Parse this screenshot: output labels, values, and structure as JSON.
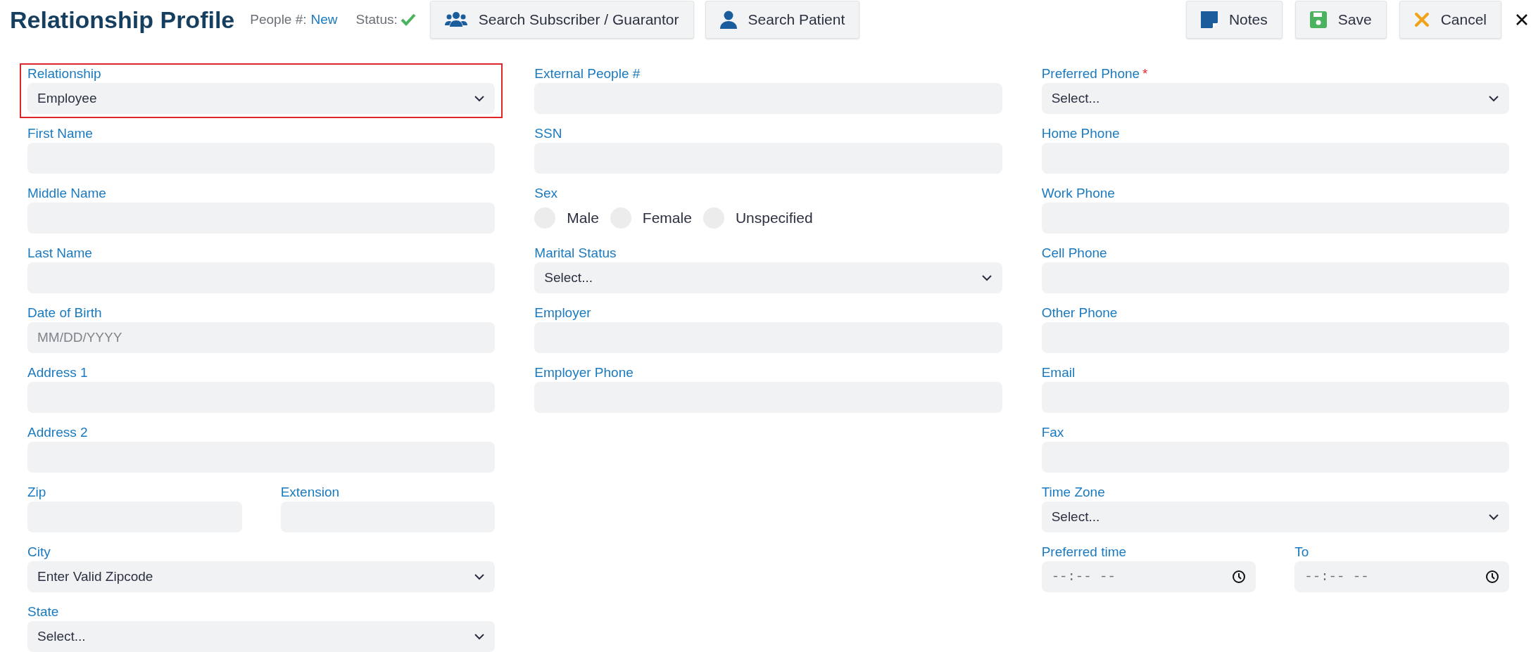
{
  "header": {
    "title": "Relationship Profile",
    "people_label": "People #:",
    "people_value": "New",
    "status_label": "Status:",
    "search_buttons": [
      {
        "label": "Search Subscriber / Guarantor",
        "kind": "group"
      },
      {
        "label": "Search Patient",
        "kind": "person"
      }
    ],
    "action_buttons": [
      {
        "label": "Notes",
        "kind": "notes"
      },
      {
        "label": "Save",
        "kind": "save"
      },
      {
        "label": "Cancel",
        "kind": "cancel"
      }
    ]
  },
  "columns": [
    [
      {
        "fields": [
          {
            "label": "Relationship",
            "kind": "select",
            "value": "Employee",
            "highlighted": true
          }
        ]
      },
      {
        "fields": [
          {
            "label": "First Name",
            "kind": "text",
            "highlighted": false
          }
        ]
      },
      {
        "fields": [
          {
            "label": "Middle Name",
            "kind": "text",
            "highlighted": false
          }
        ]
      },
      {
        "fields": [
          {
            "label": "Last Name",
            "kind": "text",
            "highlighted": false
          }
        ]
      },
      {
        "fields": [
          {
            "label": "Date of Birth",
            "kind": "text",
            "placeholder": "MM/DD/YYYY",
            "highlighted": false
          }
        ]
      },
      {
        "fields": [
          {
            "label": "Address 1",
            "kind": "text",
            "highlighted": false
          }
        ]
      },
      {
        "fields": [
          {
            "label": "Address 2",
            "kind": "text",
            "highlighted": false
          }
        ]
      },
      {
        "fields": [
          {
            "label": "Zip",
            "kind": "text",
            "highlighted": false
          },
          {
            "label": "Extension",
            "kind": "text",
            "highlighted": false
          }
        ]
      },
      {
        "fields": [
          {
            "label": "City",
            "kind": "select",
            "value": "Enter Valid Zipcode",
            "highlighted": false
          }
        ]
      },
      {
        "fields": [
          {
            "label": "State",
            "kind": "select",
            "value": "Select...",
            "highlighted": false
          }
        ]
      }
    ],
    [
      {
        "fields": [
          {
            "label": "External People #",
            "kind": "text",
            "highlighted": false
          }
        ]
      },
      {
        "fields": [
          {
            "label": "SSN",
            "kind": "text",
            "highlighted": false
          }
        ]
      },
      {
        "fields": [
          {
            "label": "Sex",
            "kind": "radio",
            "highlighted": false,
            "options": [
              {
                "label": "Male",
                "selected": false
              },
              {
                "label": "Female",
                "selected": false
              },
              {
                "label": "Unspecified",
                "selected": false
              }
            ]
          }
        ]
      },
      {
        "fields": [
          {
            "label": "Marital Status",
            "kind": "select",
            "value": "Select...",
            "highlighted": false
          }
        ]
      },
      {
        "fields": [
          {
            "label": "Employer",
            "kind": "text",
            "highlighted": false
          }
        ]
      },
      {
        "fields": [
          {
            "label": "Employer Phone",
            "kind": "text",
            "highlighted": false
          }
        ]
      }
    ],
    [
      {
        "fields": [
          {
            "label": "Preferred Phone",
            "required_mark": "*",
            "kind": "select",
            "value": "Select...",
            "highlighted": false
          }
        ]
      },
      {
        "fields": [
          {
            "label": "Home Phone",
            "kind": "text",
            "highlighted": false
          }
        ]
      },
      {
        "fields": [
          {
            "label": "Work Phone",
            "kind": "text",
            "highlighted": false
          }
        ]
      },
      {
        "fields": [
          {
            "label": "Cell Phone",
            "kind": "text",
            "highlighted": false
          }
        ]
      },
      {
        "fields": [
          {
            "label": "Other Phone",
            "kind": "text",
            "highlighted": false
          }
        ]
      },
      {
        "fields": [
          {
            "label": "Email",
            "kind": "text",
            "highlighted": false
          }
        ]
      },
      {
        "fields": [
          {
            "label": "Fax",
            "kind": "text",
            "highlighted": false
          }
        ]
      },
      {
        "fields": [
          {
            "label": "Time Zone",
            "kind": "select",
            "value": "Select...",
            "highlighted": false
          }
        ]
      },
      {
        "fields": [
          {
            "label": "Preferred time",
            "kind": "time",
            "placeholder": "--:-- --",
            "highlighted": false
          },
          {
            "label": "To",
            "kind": "time",
            "placeholder": "--:-- --",
            "highlighted": false
          }
        ]
      }
    ]
  ]
}
